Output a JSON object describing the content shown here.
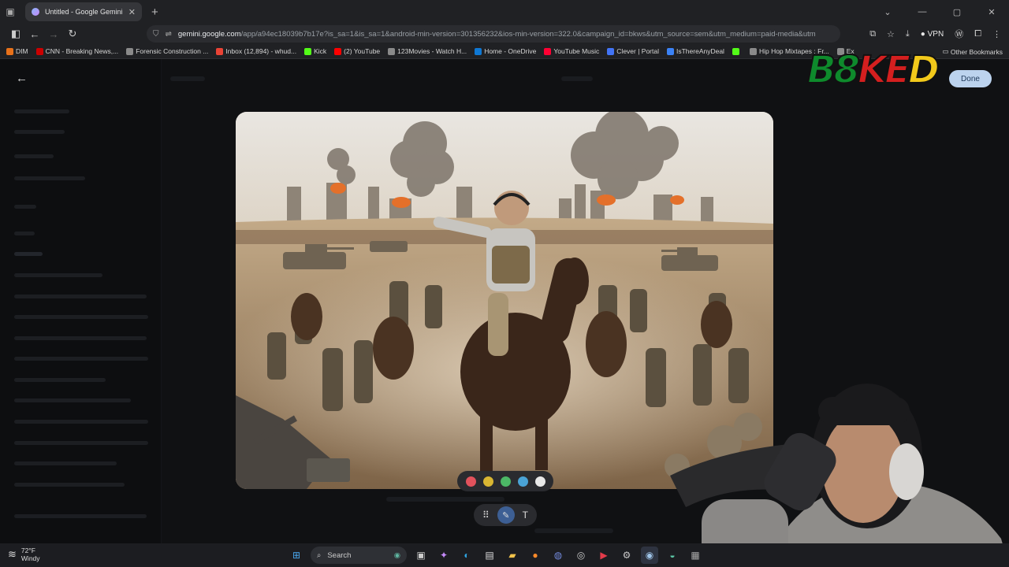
{
  "browser": {
    "tab_title": "Untitled - Google Gemini",
    "new_tab": "+",
    "url_host": "gemini.google.com",
    "url_rest": "/app/a94ec18039b7b17e?is_sa=1&is_sa=1&android-min-version=301356232&ios-min-version=322.0&campaign_id=bkws&utm_source=sem&utm_medium=paid-media&utm",
    "vpn_label": "VPN",
    "window_controls": [
      "—",
      "▢",
      "✕"
    ]
  },
  "bookmarks": [
    {
      "label": "DIM",
      "color": "#e8711a"
    },
    {
      "label": "CNN - Breaking News,...",
      "color": "#cc0000"
    },
    {
      "label": "Forensic Construction ...",
      "color": "#8a8a8a"
    },
    {
      "label": "Inbox (12,894) - whud...",
      "color": "#ea4335"
    },
    {
      "label": "Kick",
      "color": "#53fc18"
    },
    {
      "label": "(2) YouTube",
      "color": "#ff0000"
    },
    {
      "label": "123Movies - Watch H...",
      "color": "#8a8a8a"
    },
    {
      "label": "Home - OneDrive",
      "color": "#0f78d4"
    },
    {
      "label": "YouTube Music",
      "color": "#ff0033"
    },
    {
      "label": "Clever | Portal",
      "color": "#4274f6"
    },
    {
      "label": "IsThereAnyDeal",
      "color": "#3b82f6"
    },
    {
      "label": "",
      "color": "#53fc18"
    },
    {
      "label": "Hip Hop Mixtapes : Fr...",
      "color": "#8a8a8a"
    },
    {
      "label": "Ex",
      "color": "#8a8a8a"
    }
  ],
  "bookmarks_other": "Other Bookmarks",
  "editor": {
    "done_label": "Done",
    "palette": [
      "#e2525c",
      "#d9b632",
      "#4cb866",
      "#4aa3d6",
      "#e8e8e8"
    ],
    "text_tool": "T"
  },
  "overlay": {
    "logo_letters": [
      "B",
      "8",
      "K",
      "E",
      "D"
    ],
    "logo_colors": [
      "#0e8a2c",
      "#0e8a2c",
      "#d41f1f",
      "#d41f1f",
      "#f2c91b"
    ]
  },
  "taskbar": {
    "temperature": "72°F",
    "condition": "Windy",
    "search_placeholder": "Search"
  }
}
